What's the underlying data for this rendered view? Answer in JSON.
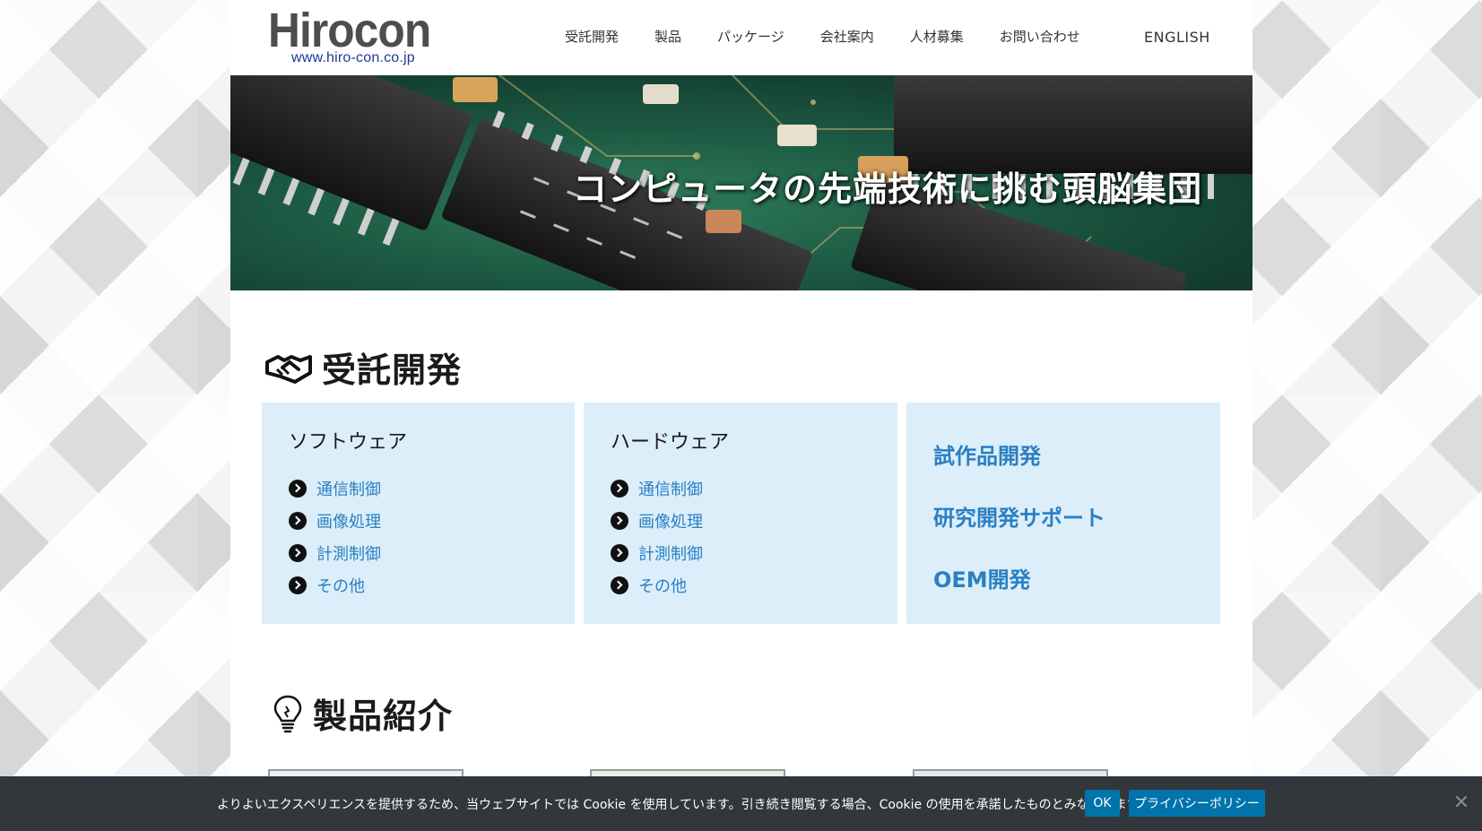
{
  "header": {
    "logo_main": "Hirocon",
    "logo_sub": "www.hiro-con.co.jp",
    "nav": [
      "受託開発",
      "製品",
      "パッケージ",
      "会社案内",
      "人材募集",
      "お問い合わせ"
    ],
    "english": "ENGLISH"
  },
  "hero": {
    "tagline": "コンピュータの先端技術に挑む頭脳集団"
  },
  "contract": {
    "title": "受託開発",
    "icon": "handshake-icon",
    "software": {
      "title": "ソフトウェア",
      "items": [
        "通信制御",
        "画像処理",
        "計測制御",
        "その他"
      ]
    },
    "hardware": {
      "title": "ハードウェア",
      "items": [
        "通信制御",
        "画像処理",
        "計測制御",
        "その他"
      ]
    },
    "other": {
      "items": [
        "試作品開発",
        "研究開発サポート",
        "OEM開発"
      ]
    }
  },
  "products": {
    "title": "製品紹介",
    "icon": "lightbulb-icon"
  },
  "cookie": {
    "text": "よりよいエクスペリエンスを提供するため、当ウェブサイトでは Cookie を使用しています。引き続き閲覧する場合、Cookie の使用を承諾したものとみなされます。",
    "ok": "OK",
    "privacy": "プライバシーポリシー"
  },
  "colors": {
    "card_bg": "#dbeef9",
    "link": "#2b7fc2",
    "cookie_bg": "#32373c",
    "button": "#0073aa"
  }
}
